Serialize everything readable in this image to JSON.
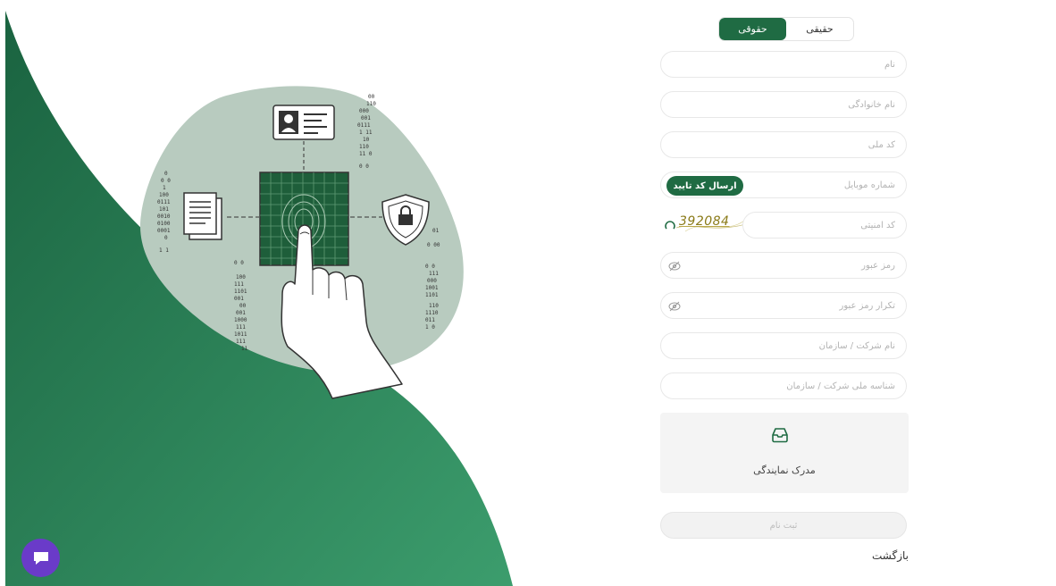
{
  "colors": {
    "brand": "#1f6b43",
    "art_gradient_top": "#1d6a43",
    "art_gradient_bottom": "#3b9c6c",
    "blob": "#b8cbbf",
    "chat_bubble": "#6a3bc9"
  },
  "tabs": [
    {
      "label": "حقیقی",
      "active": false
    },
    {
      "label": "حقوقی",
      "active": true
    }
  ],
  "fields": {
    "first_name": "نام",
    "last_name": "نام خانوادگی",
    "national_code": "کد ملی",
    "mobile": "شماره موبایل",
    "security_code": "کد امنیتی",
    "password": "رمز عبور",
    "password_repeat": "تکرار رمز عبور",
    "company_name": "نام شرکت / سازمان",
    "company_id": "شناسه ملی شرکت / سازمان"
  },
  "send_code_button": "ارسال کد تایید",
  "captcha": {
    "code": "392084",
    "refresh_icon": "refresh-icon"
  },
  "password_toggle_icon": "eye-off-icon",
  "upload": {
    "label": "مدرک نمایندگی",
    "icon": "inbox-icon"
  },
  "submit_button": "ثبت نام",
  "back_link": "بازگشت",
  "chat_icon": "chat-bubble-icon",
  "illustration": {
    "description_icons": [
      "id-card-icon",
      "document-icon",
      "fingerprint-scanner-icon",
      "shield-lock-icon",
      "hand-icon"
    ]
  }
}
